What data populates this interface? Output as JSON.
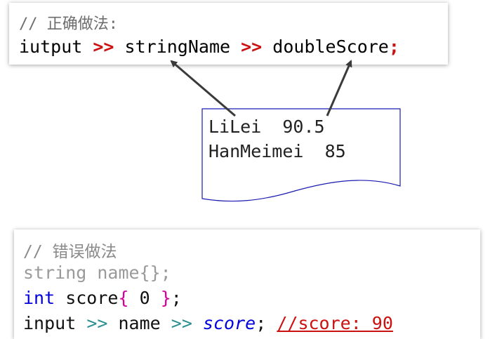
{
  "correct_block": {
    "comment": "// 正确做法:",
    "stream": "iutput",
    "op1": ">>",
    "var1": "stringName",
    "op2": ">>",
    "var2": "doubleScore",
    "semi": ";"
  },
  "input_file": {
    "line1": "LiLei  90.5",
    "line2": "HanMeimei  85"
  },
  "wrong_block": {
    "comment": "// 错误做法",
    "decl_string": "string name{};",
    "int_kw": "int",
    "int_name": " score",
    "brace_open": "{",
    "int_value": " 0 ",
    "brace_close": "}",
    "int_semi": ";",
    "stream": "input",
    "op1": ">>",
    "var1": "name",
    "op2": ">>",
    "var2": "score",
    "semi": ";",
    "note": "//score: 90"
  },
  "colors": {
    "operator_red": "#cc1111",
    "keyword_blue": "#0000dd",
    "brace_pink": "#d4009a",
    "operator_teal": "#2a8f8f",
    "file_border_blue": "#1a1ab0"
  }
}
